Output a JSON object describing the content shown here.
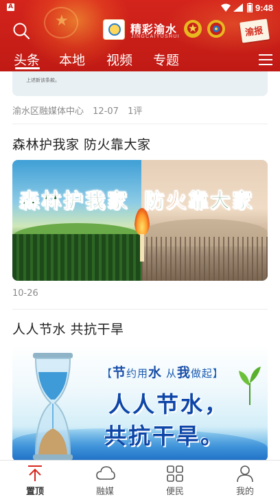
{
  "status_bar": {
    "notification_icon": "A",
    "time": "9:48"
  },
  "app": {
    "logo_text": "精彩渝水",
    "logo_subtitle": "JINGCAIYUSHUI",
    "stamp_text": "渝报"
  },
  "tabs": [
    {
      "label": "头条",
      "active": true
    },
    {
      "label": "本地",
      "active": false
    },
    {
      "label": "视频",
      "active": false
    },
    {
      "label": "专题",
      "active": false
    }
  ],
  "feed": {
    "previous_article": {
      "image_caption": "上述新该条款。",
      "source": "渝水区融媒体中心",
      "date": "12-07",
      "comments": "1评"
    },
    "articles": [
      {
        "title": "森林护我家 防火靠大家",
        "image_text_left": "森林护我家",
        "image_text_right_a": "防",
        "image_text_right_fire": "火",
        "image_text_right_b": "靠大家",
        "date": "10-26"
      },
      {
        "title": "人人节水 共抗干旱",
        "image_banner_a": "【",
        "image_banner_b": "节",
        "image_banner_c": "约用",
        "image_banner_d": "水",
        "image_banner_e": " 从",
        "image_banner_f": "我",
        "image_banner_g": "做起】",
        "image_line1": "人人节水，",
        "image_line2": "共抗干旱。"
      }
    ]
  },
  "bottom_nav": [
    {
      "label": "置顶",
      "icon": "arrow-up-icon",
      "active": true
    },
    {
      "label": "融媒",
      "icon": "cloud-icon",
      "active": false
    },
    {
      "label": "便民",
      "icon": "grid-icon",
      "active": false
    },
    {
      "label": "我的",
      "icon": "user-icon",
      "active": false
    }
  ],
  "colors": {
    "header_red": "#c81e18",
    "active_nav_red": "#d8261c"
  }
}
